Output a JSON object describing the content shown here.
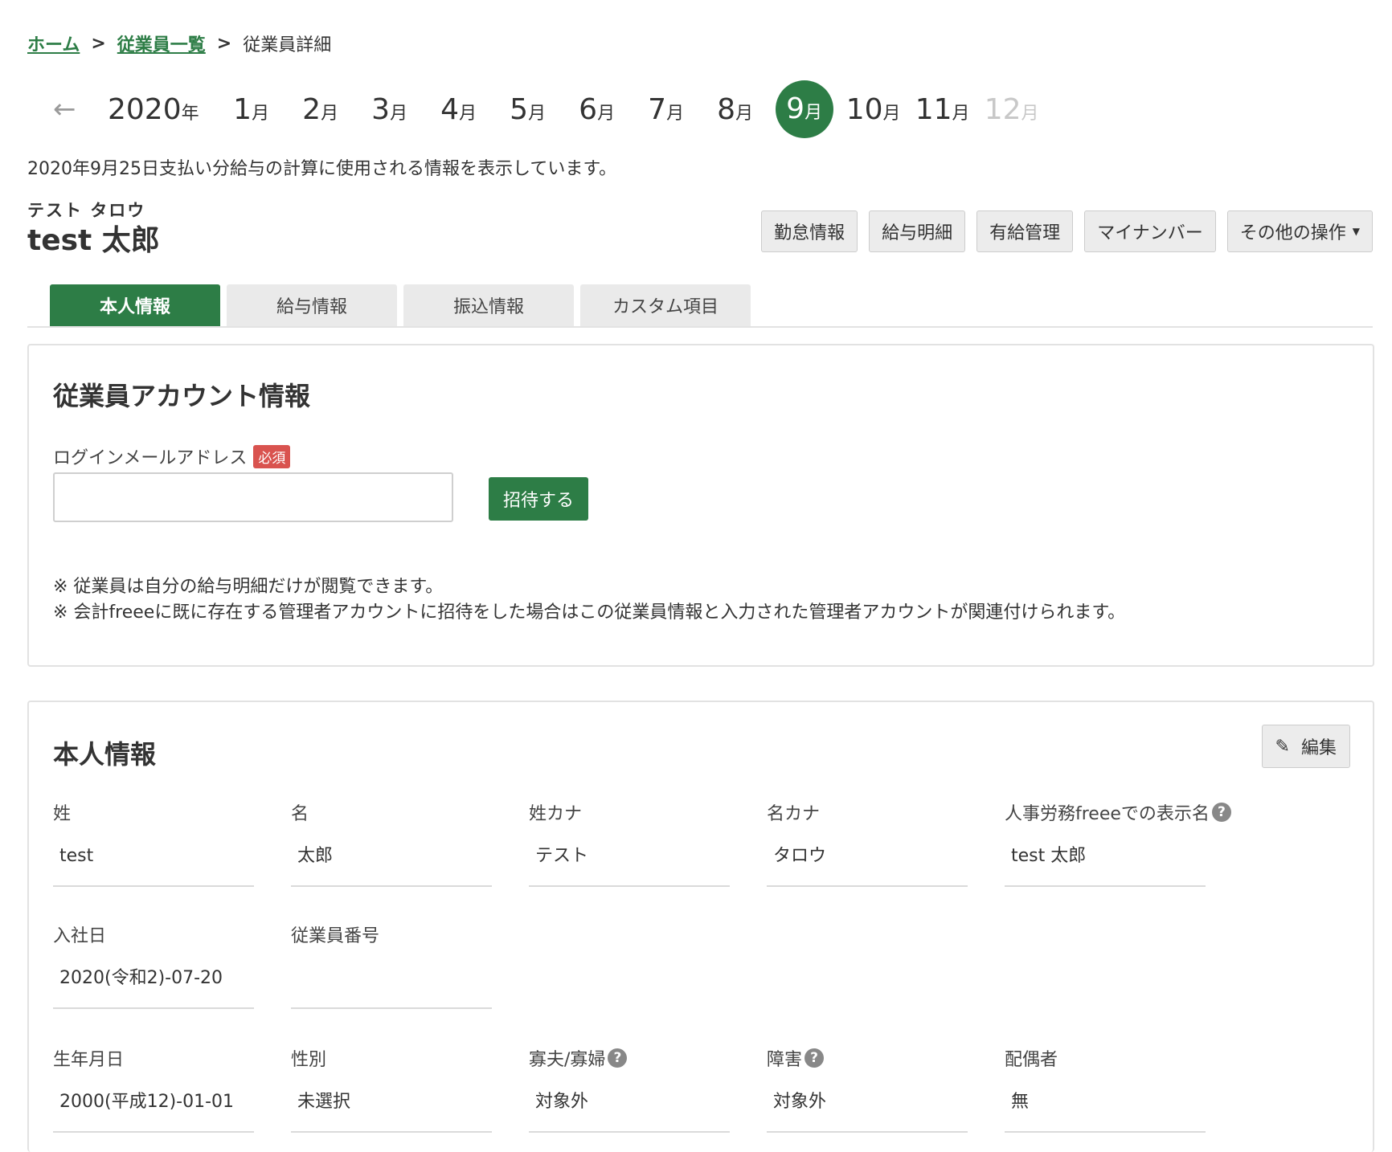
{
  "breadcrumb": {
    "home": "ホーム",
    "list": "従業員一覧",
    "current": "従業員詳細",
    "sep": ">"
  },
  "months": {
    "prev_arrow": "←",
    "year": "2020",
    "year_unit": "年",
    "month_unit": "月",
    "items": [
      {
        "num": "1"
      },
      {
        "num": "2"
      },
      {
        "num": "3"
      },
      {
        "num": "4"
      },
      {
        "num": "5"
      },
      {
        "num": "6"
      },
      {
        "num": "7"
      },
      {
        "num": "8"
      },
      {
        "num": "9"
      },
      {
        "num": "10"
      },
      {
        "num": "11"
      },
      {
        "num": "12"
      }
    ],
    "selected": "9"
  },
  "notice": "2020年9月25日支払い分給与の計算に使用される情報を表示しています。",
  "employee": {
    "kana": "テスト タロウ",
    "name": "test 太郎"
  },
  "actions": {
    "attendance": "勤怠情報",
    "payslip": "給与明細",
    "paid_leave": "有給管理",
    "my_number": "マイナンバー",
    "other": "その他の操作"
  },
  "tabs": {
    "personal": "本人情報",
    "salary": "給与情報",
    "transfer": "振込情報",
    "custom": "カスタム項目"
  },
  "account": {
    "title": "従業員アカウント情報",
    "email_label": "ログインメールアドレス",
    "required": "必須",
    "email_value": "",
    "invite": "招待する",
    "note1": "※ 従業員は自分の給与明細だけが閲覧できます。",
    "note2": "※ 会計freeeに既に存在する管理者アカウントに招待をした場合はこの従業員情報と入力された管理者アカウントが関連付けられます。"
  },
  "personal": {
    "title": "本人情報",
    "edit": "編集",
    "help": "?",
    "fields": {
      "last_name": {
        "label": "姓",
        "value": "test"
      },
      "first_name": {
        "label": "名",
        "value": "太郎"
      },
      "last_kana": {
        "label": "姓カナ",
        "value": "テスト"
      },
      "first_kana": {
        "label": "名カナ",
        "value": "タロウ"
      },
      "display_name": {
        "label": "人事労務freeeでの表示名",
        "value": "test 太郎"
      },
      "hire_date": {
        "label": "入社日",
        "value": "2020(令和2)-07-20"
      },
      "employee_no": {
        "label": "従業員番号",
        "value": ""
      },
      "birthday": {
        "label": "生年月日",
        "value": "2000(平成12)-01-01"
      },
      "gender": {
        "label": "性別",
        "value": "未選択"
      },
      "widow": {
        "label": "寡夫/寡婦",
        "value": "対象外"
      },
      "disability": {
        "label": "障害",
        "value": "対象外"
      },
      "spouse": {
        "label": "配偶者",
        "value": "無"
      }
    }
  }
}
